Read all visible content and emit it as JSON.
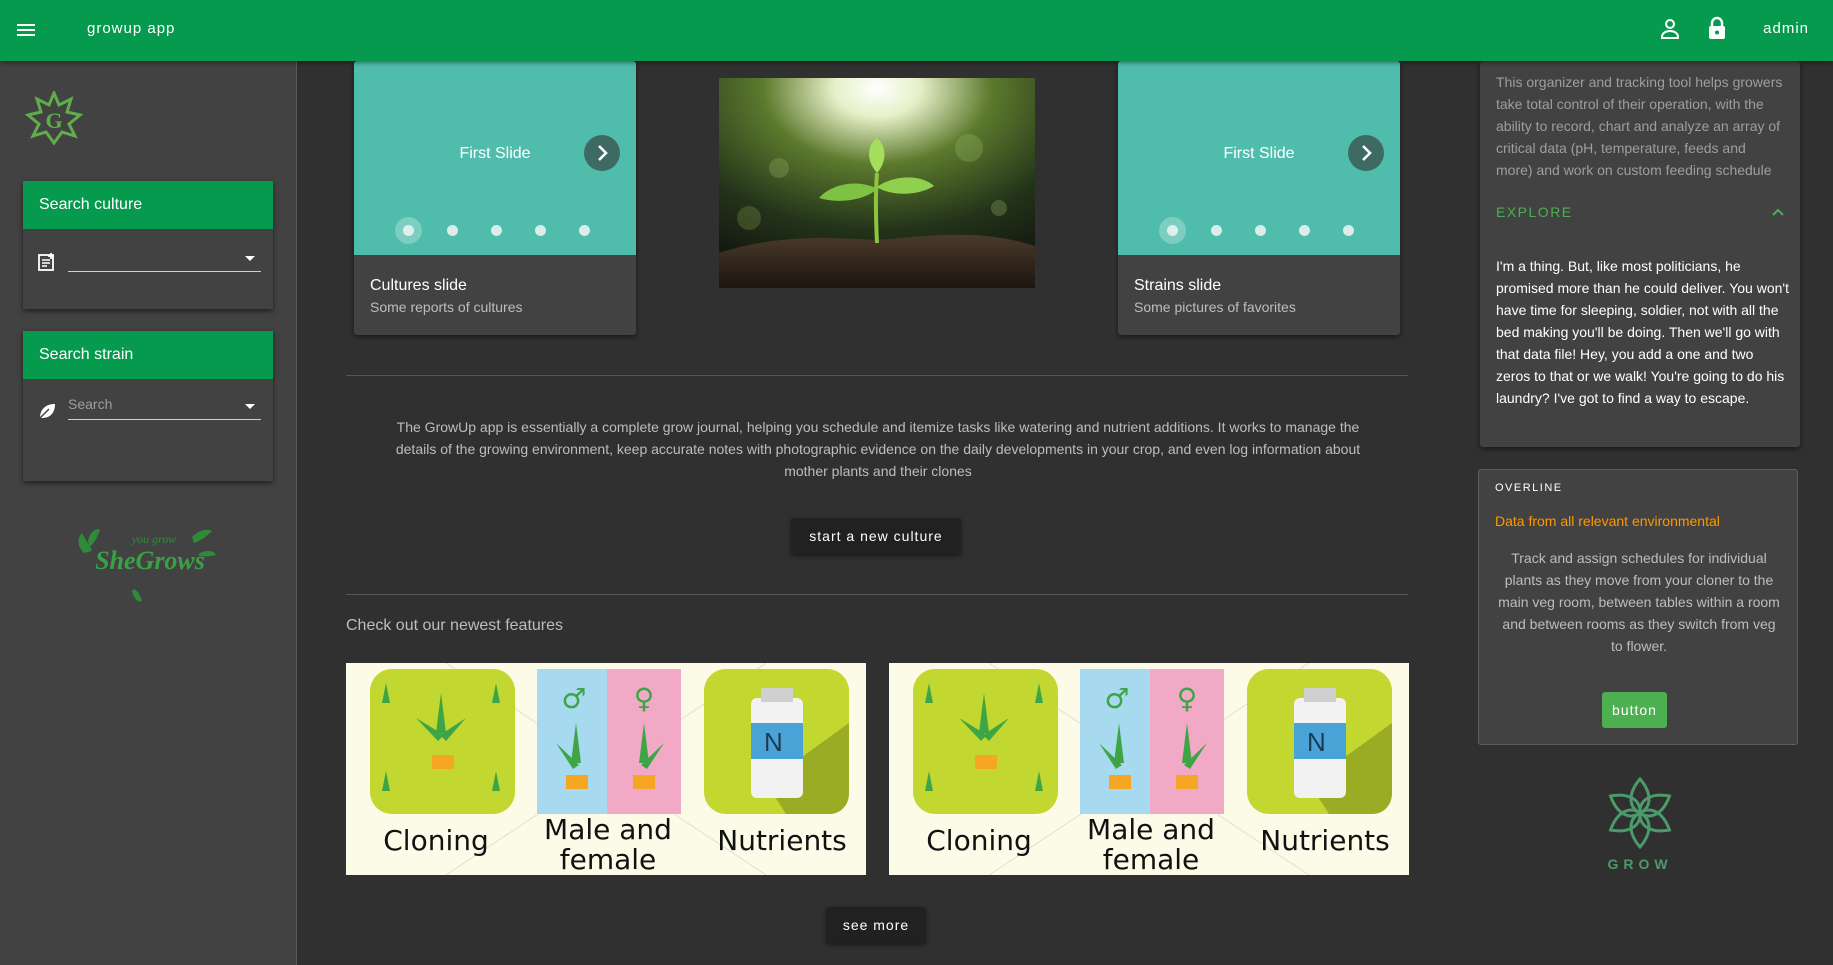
{
  "app": {
    "title": "growup app",
    "user": "admin"
  },
  "sidebar": {
    "search_culture": {
      "title": "Search culture",
      "placeholder": ""
    },
    "search_strain": {
      "title": "Search strain",
      "placeholder": "Search"
    }
  },
  "main": {
    "slides": [
      {
        "slide_title": "First Slide",
        "title": "Cultures slide",
        "subtitle": "Some reports of cultures",
        "active_dot": 1,
        "dot_count": 5
      },
      {
        "slide_title": "First Slide",
        "title": "Strains slide",
        "subtitle": "Some pictures of favorites",
        "active_dot": 1,
        "dot_count": 5
      }
    ],
    "description": "The GrowUp app is essentially a complete grow journal, helping you schedule and itemize tasks like watering and nutrient additions. It works to manage the details of the growing environment, keep accurate notes with photographic evidence on the daily developments in your crop, and even log information about mother plants and their clones",
    "start_button": "start a new culture",
    "features_heading": "Check out our newest features",
    "features": [
      {
        "labels": [
          "Cloning",
          "Male and",
          "female",
          "Nutrients"
        ]
      },
      {
        "labels": [
          "Cloning",
          "Male and",
          "female",
          "Nutrients"
        ]
      }
    ],
    "see_more_button": "see more"
  },
  "right": {
    "top_text": "This organizer and tracking tool helps growers take total control of their operation, with the ability to record, chart and analyze an array of critical data (pH, temperature, feeds and more) and work on custom feeding schedule",
    "explore_label": "EXPLORE",
    "explore_text": "I'm a thing. But, like most politicians, he promised more than he could deliver. You won't have time for sleeping, soldier, not with all the bed making you'll be doing. Then we'll go with that data file! Hey, you add a one and two zeros to that or we walk! You're going to do his laundry? I've got to find a way to escape.",
    "overline": "OVERLINE",
    "card_title": "Data from all relevant environmental",
    "card_text": "Track and assign schedules for individual plants as they move from your cloner to the main veg room, between tables within a room and between rooms as they switch from veg to flower.",
    "card_button": "button",
    "logo_text": "GROW"
  },
  "colors": {
    "primary": "#069a4f",
    "slide_bg": "#50bcab",
    "accent_orange": "#ff9800",
    "accent_green": "#4caf50"
  }
}
